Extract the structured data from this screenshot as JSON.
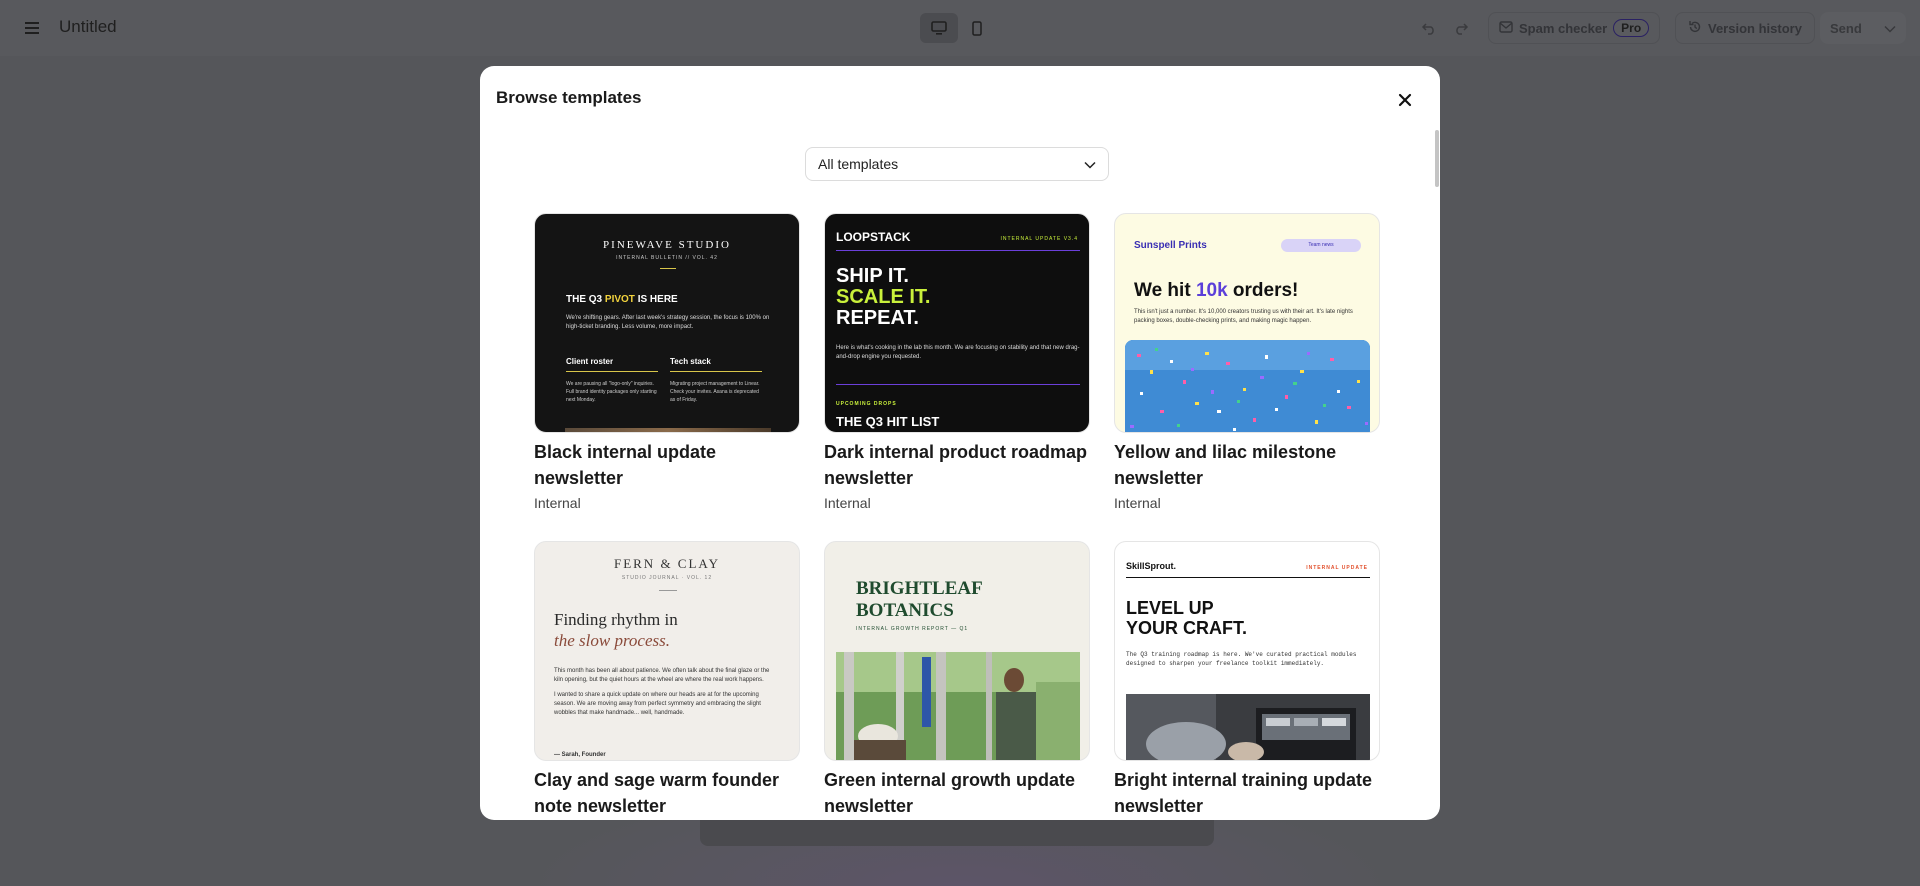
{
  "app": {
    "doc_title": "Untitled",
    "spam_checker_label": "Spam checker",
    "pro_badge": "Pro",
    "version_history_label": "Version history",
    "send_label": "Send"
  },
  "modal": {
    "title": "Browse templates",
    "filter": {
      "selected": "All templates"
    },
    "templates": [
      {
        "title": "Black internal update newsletter",
        "category": "Internal",
        "preview": {
          "brand": "PINEWAVE STUDIO",
          "sub": "INTERNAL BULLETIN // VOL. 42",
          "head_a": "THE Q3 ",
          "head_hl": "PIVOT",
          "head_b": " IS HERE",
          "para": "We're shifting gears. After last week's strategy session, the focus is 100% on high-ticket branding. Less volume, more impact.",
          "col1_head": "Client roster",
          "col1_text": "We are pausing all \"logo-only\" inquiries. Full brand identity packages only starting next Monday.",
          "col2_head": "Tech stack",
          "col2_text": "Migrating project management to Linear. Check your invites. Asana is deprecated as of Friday."
        }
      },
      {
        "title": "Dark internal product roadmap newsletter",
        "category": "Internal",
        "preview": {
          "brand": "LOOPSTACK",
          "tag": "INTERNAL UPDATE V3.4",
          "line1": "SHIP IT.",
          "line2": "SCALE IT.",
          "line3": "REPEAT.",
          "para": "Here is what's cooking in the lab this month. We are focusing on stability and that new drag-and-drop engine you requested.",
          "drops": "UPCOMING DROPS",
          "list": "THE Q3 HIT LIST"
        }
      },
      {
        "title": "Yellow and lilac milestone newsletter",
        "category": "Internal",
        "preview": {
          "brand": "Sunspell Prints",
          "pill": "Team news",
          "head_a": "We hit ",
          "head_hl": "10k",
          "head_b": " orders!",
          "para": "This isn't just a number. It's 10,000 creators trusting us with their art. It's late nights packing boxes, double-checking prints, and making magic happen."
        }
      },
      {
        "title": "Clay and sage warm founder note newsletter",
        "category": "",
        "preview": {
          "brand": "FERN & CLAY",
          "sub": "STUDIO JOURNAL · VOL. 12",
          "head_a": "Finding rhythm in",
          "head_b": "the slow process.",
          "para1": "This month has been all about patience. We often talk about the final glaze or the kiln opening, but the quiet hours at the wheel are where the real work happens.",
          "para2": "I wanted to share a quick update on where our heads are at for the upcoming season. We are moving away from perfect symmetry and embracing the slight wobbles that make handmade... well, handmade.",
          "sig": "— Sarah, Founder"
        }
      },
      {
        "title": "Green internal growth update newsletter",
        "category": "",
        "preview": {
          "brand_a": "BRIGHTLEAF",
          "brand_b": "BOTANICS",
          "sub": "INTERNAL GROWTH REPORT — Q1"
        }
      },
      {
        "title": "Bright internal training update newsletter",
        "category": "",
        "preview": {
          "brand": "SkillSprout.",
          "tag": "INTERNAL UPDATE",
          "line1": "LEVEL UP",
          "line2": "YOUR CRAFT.",
          "para": "The Q3 training roadmap is here. We've curated practical modules designed to sharpen your freelance toolkit immediately."
        }
      }
    ]
  },
  "colors": {
    "overlay": "#55565a",
    "accent_yellow": "#f2d33d",
    "accent_lime": "#c9f03b",
    "accent_purple": "#5b3fd9",
    "forest_green": "#1f4b2e",
    "clay_brown": "#8a4a3a",
    "training_orange": "#e2502d"
  },
  "icons": [
    "menu-icon",
    "desktop-icon",
    "mobile-icon",
    "undo-icon",
    "redo-icon",
    "spam-icon",
    "history-icon",
    "chevron-down-icon",
    "close-icon"
  ]
}
